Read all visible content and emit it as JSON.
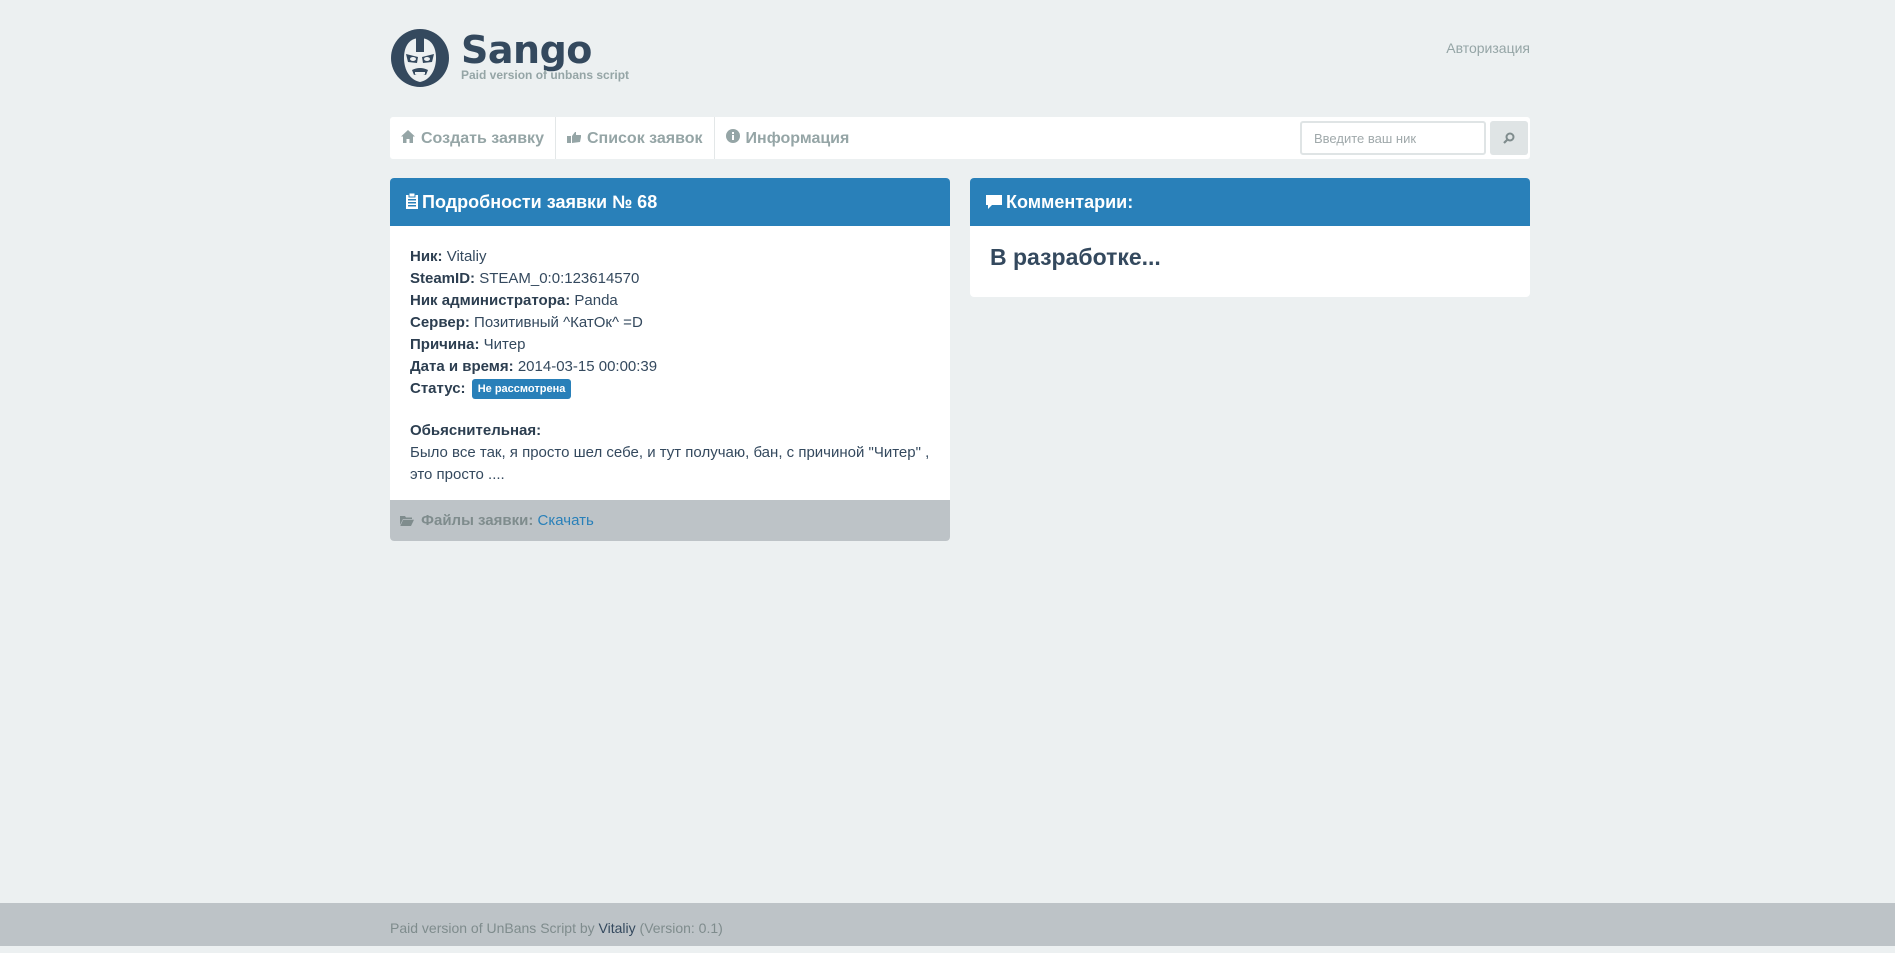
{
  "header": {
    "brand": "Sango",
    "tagline": "Paid version of unbans script",
    "login_link": "Авторизация"
  },
  "nav": {
    "items": [
      {
        "label": "Создать заявку",
        "icon": "home-icon"
      },
      {
        "label": "Список заявок",
        "icon": "hand-icon"
      },
      {
        "label": "Информация",
        "icon": "info-icon"
      }
    ],
    "search_placeholder": "Введите ваш ник",
    "search_icon": "search-icon"
  },
  "request": {
    "title": "Подробности заявки № 68",
    "fields": {
      "nick_label": "Ник:",
      "nick_value": "Vitaliy",
      "steamid_label": "SteamID:",
      "steamid_value": "STEAM_0:0:123614570",
      "admin_label": "Ник администратора:",
      "admin_value": "Panda",
      "server_label": "Сервер:",
      "server_value": "Позитивный ^КатОк^ =D",
      "reason_label": "Причина:",
      "reason_value": "Читер",
      "datetime_label": "Дата и время:",
      "datetime_value": "2014-03-15 00:00:39",
      "status_label": "Статус:",
      "status_value": "Не рассмотрена"
    },
    "explain_label": "Обьяснительная:",
    "explain_text": "Было все так, я просто шел себе, и тут получаю, бан, с причиной \"Читер\" , это просто ....",
    "files_label": "Файлы заявки:",
    "files_link": "Скачать"
  },
  "comments": {
    "title": "Комментарии:",
    "placeholder": "В разработке..."
  },
  "footer": {
    "text_prefix": "Paid version of UnBans Script by",
    "author": "Vitaliy",
    "version": "(Version: 0.1)"
  },
  "colors": {
    "accent": "#2980b9",
    "background": "#ecf0f1",
    "footer": "#bdc3c7"
  }
}
